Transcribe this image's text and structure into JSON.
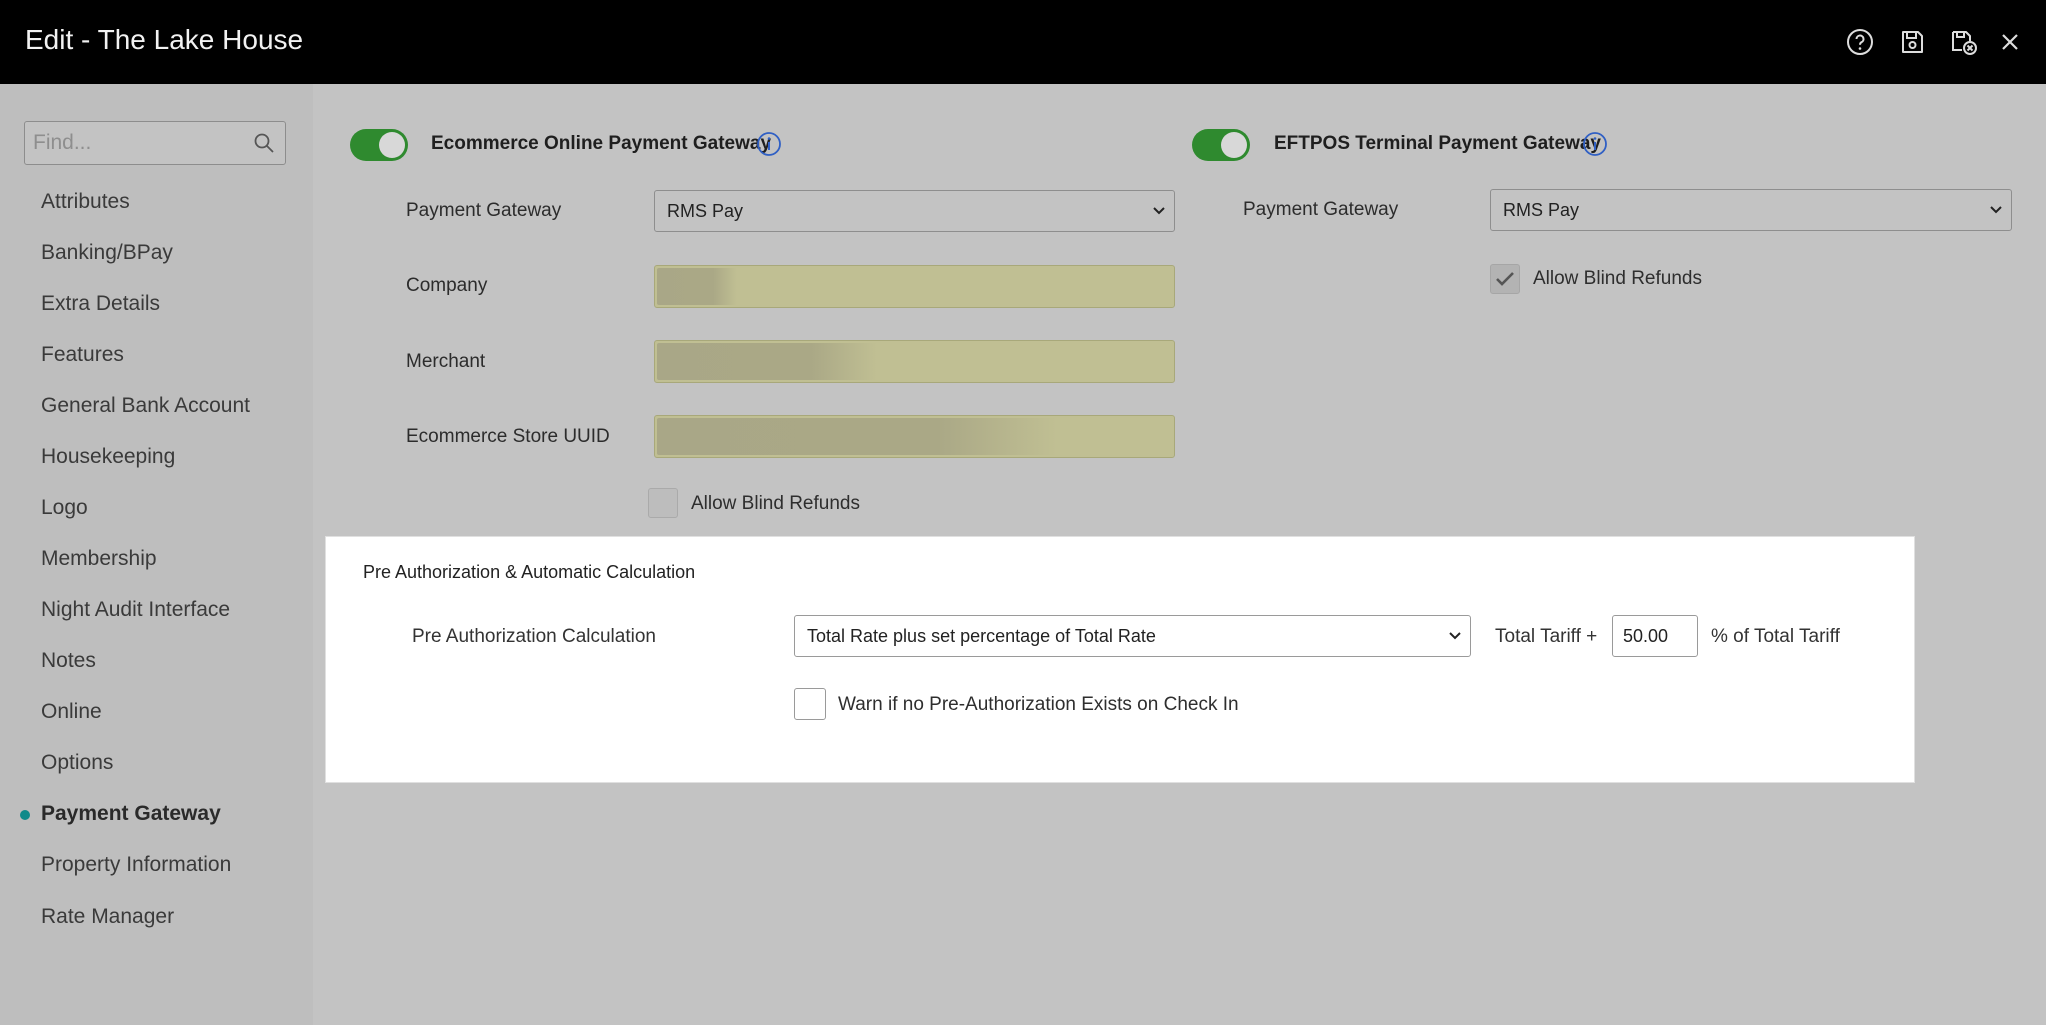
{
  "header": {
    "title": "Edit - The Lake House"
  },
  "sidebar": {
    "search_placeholder": "Find...",
    "items": [
      {
        "label": "Attributes"
      },
      {
        "label": "Banking/BPay"
      },
      {
        "label": "Extra Details"
      },
      {
        "label": "Features"
      },
      {
        "label": "General Bank Account"
      },
      {
        "label": "Housekeeping"
      },
      {
        "label": "Logo"
      },
      {
        "label": "Membership"
      },
      {
        "label": "Night Audit Interface"
      },
      {
        "label": "Notes"
      },
      {
        "label": "Online"
      },
      {
        "label": "Options"
      },
      {
        "label": "Payment Gateway",
        "active": true
      },
      {
        "label": "Property Information"
      },
      {
        "label": "Rate Manager"
      }
    ]
  },
  "ecommerce": {
    "enabled": true,
    "title": "Ecommerce Online Payment Gateway",
    "gateway_label": "Payment Gateway",
    "gateway_value": "RMS Pay",
    "company_label": "Company",
    "merchant_label": "Merchant",
    "store_uuid_label": "Ecommerce Store UUID",
    "allow_blind_refunds_label": "Allow Blind Refunds",
    "allow_blind_refunds": false
  },
  "eftpos": {
    "enabled": true,
    "title": "EFTPOS Terminal Payment Gateway",
    "gateway_label": "Payment Gateway",
    "gateway_value": "RMS Pay",
    "allow_blind_refunds_label": "Allow Blind Refunds",
    "allow_blind_refunds": true
  },
  "preauth": {
    "title": "Pre Authorization & Automatic Calculation",
    "calc_label": "Pre Authorization Calculation",
    "calc_value": "Total Rate plus set percentage of Total Rate",
    "tariff_prefix": "Total Tariff +",
    "tariff_value": "50.00",
    "tariff_suffix": "% of Total Tariff",
    "warn_label": "Warn if no Pre-Authorization Exists on Check In",
    "warn_checked": false
  },
  "colors": {
    "header_bg": "#000000",
    "toggle_on": "#2f8a2f",
    "active_dot": "#0e8a8a",
    "info_icon": "#2f5fc4"
  }
}
